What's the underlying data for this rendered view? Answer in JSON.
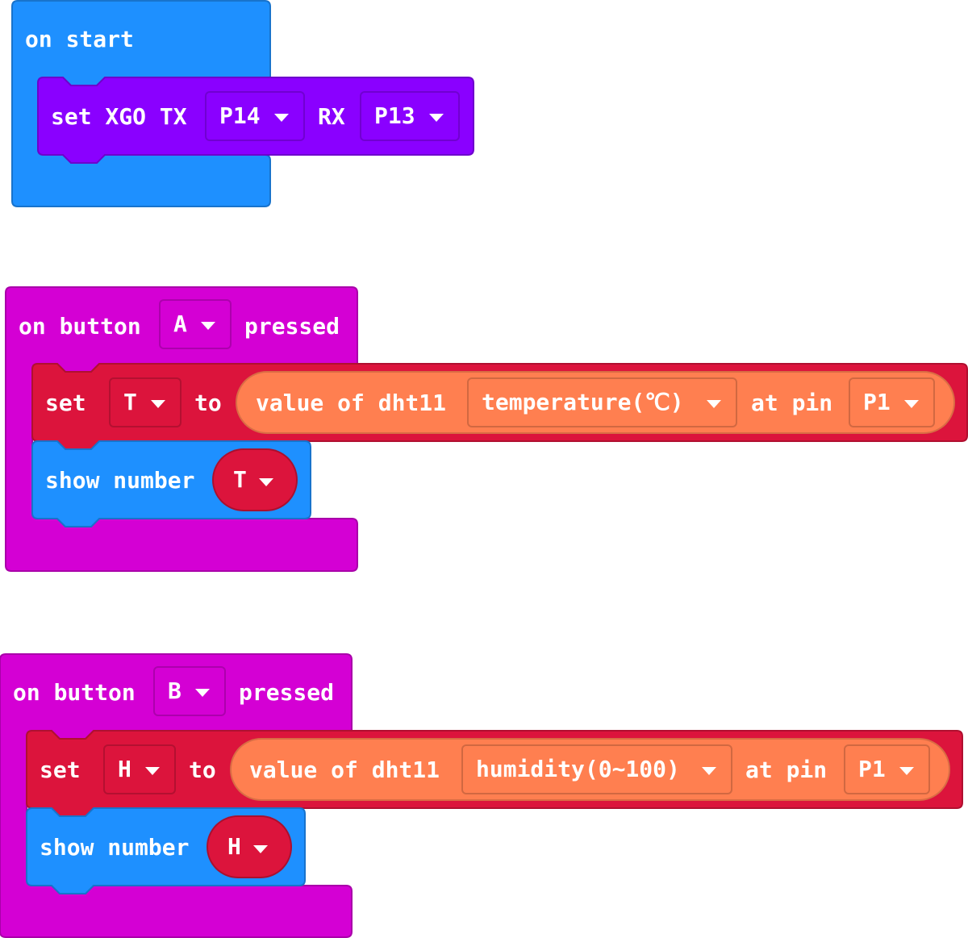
{
  "colors": {
    "basic": "#1E90FF",
    "xgo": "#8A00FF",
    "input": "#D400D4",
    "variables": "#DC143C",
    "dht11": "#FF7F50"
  },
  "on_start": {
    "label": "on start",
    "set_xgo": {
      "set_label": "set XGO TX",
      "tx_value": "P14",
      "rx_label": "RX",
      "rx_value": "P13"
    }
  },
  "button_a": {
    "on_label": "on button",
    "button_value": "A",
    "pressed_label": "pressed",
    "set_label": "set",
    "variable": "T",
    "to_label": "to",
    "reporter_label": "value of dht11",
    "measure_value": "temperature(℃)",
    "at_pin_label": "at pin",
    "pin_value": "P1",
    "show_label": "show number",
    "show_variable": "T"
  },
  "button_b": {
    "on_label": "on button",
    "button_value": "B",
    "pressed_label": "pressed",
    "set_label": "set",
    "variable": "H",
    "to_label": "to",
    "reporter_label": "value of dht11",
    "measure_value": "humidity(0~100)",
    "at_pin_label": "at pin",
    "pin_value": "P1",
    "show_label": "show number",
    "show_variable": "H"
  }
}
